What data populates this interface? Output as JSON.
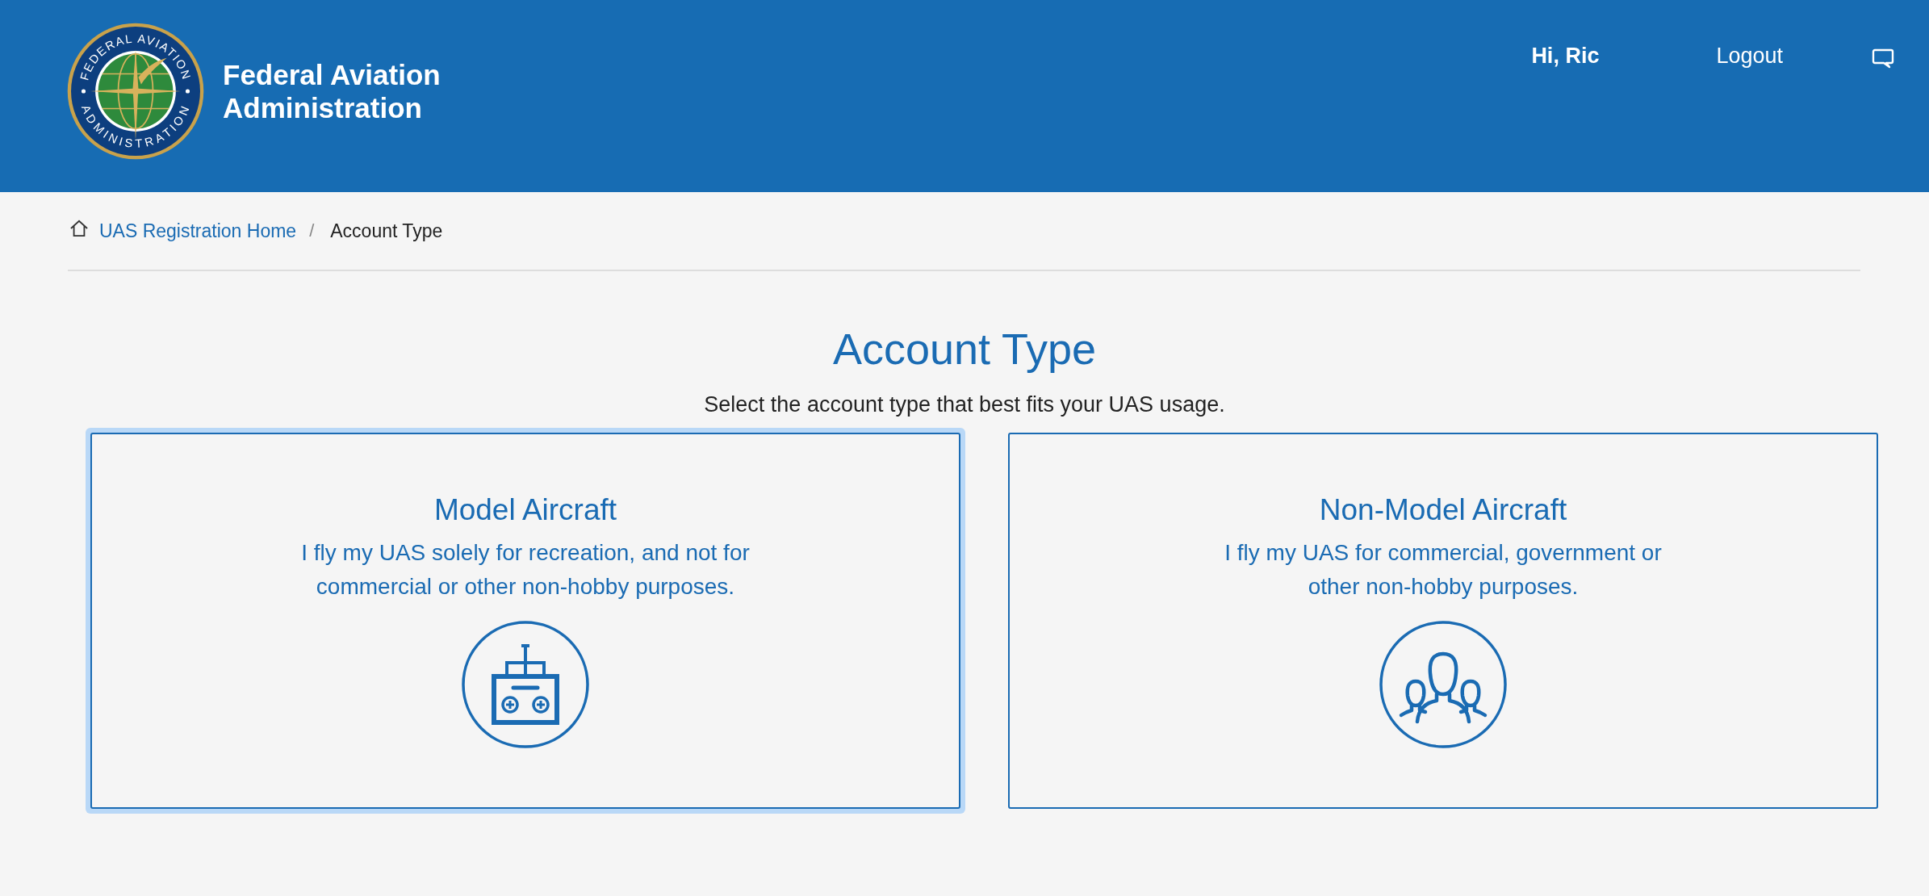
{
  "header": {
    "seal_top": "FEDERAL AVIATION",
    "seal_bottom": "ADMINISTRATION",
    "agency_name": "Federal Aviation Administration",
    "greeting": "Hi, Ric",
    "logout": "Logout"
  },
  "breadcrumb": {
    "home": "UAS Registration Home",
    "separator": "/",
    "current": "Account Type"
  },
  "page": {
    "title": "Account Type",
    "subtitle": "Select the account type that best fits your UAS usage."
  },
  "cards": [
    {
      "title": "Model Aircraft",
      "description": "I fly my UAS solely for recreation, and not for commercial or other non-hobby purposes.",
      "kind": "controller",
      "selected": true
    },
    {
      "title": "Non-Model Aircraft",
      "description": "I fly my UAS for commercial, government or other non-hobby purposes.",
      "kind": "people",
      "selected": false
    }
  ]
}
